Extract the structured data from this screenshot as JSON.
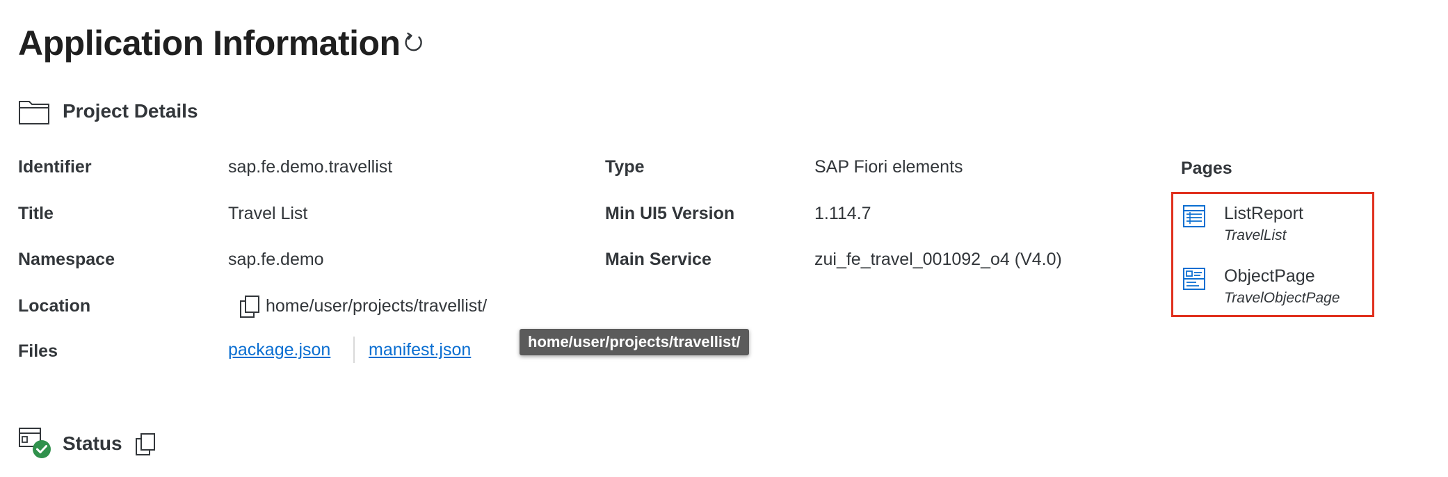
{
  "page": {
    "title": "Application Information",
    "refresh_icon": "refresh-icon"
  },
  "project_details": {
    "section_title": "Project Details",
    "icon": "folder-icon",
    "fields": {
      "identifier": {
        "label": "Identifier",
        "value": "sap.fe.demo.travellist"
      },
      "title": {
        "label": "Title",
        "value": "Travel List"
      },
      "namespace": {
        "label": "Namespace",
        "value": "sap.fe.demo"
      },
      "location": {
        "label": "Location",
        "value": "home/user/projects/travellist/"
      },
      "files": {
        "label": "Files",
        "items": [
          "package.json",
          "manifest.json"
        ]
      },
      "type": {
        "label": "Type",
        "value": "SAP Fiori elements"
      },
      "min_ui5": {
        "label": "Min UI5 Version",
        "value": "1.114.7"
      },
      "main_service": {
        "label": "Main Service",
        "value": "zui_fe_travel_001092_o4 (V4.0)"
      }
    },
    "tooltip": "home/user/projects/travellist/",
    "pages": {
      "label": "Pages",
      "items": [
        {
          "name": "ListReport",
          "entity": "TravelList",
          "icon": "list-report-icon"
        },
        {
          "name": "ObjectPage",
          "entity": "TravelObjectPage",
          "icon": "object-page-icon"
        }
      ]
    }
  },
  "status": {
    "section_title": "Status",
    "icon": "status-check-icon"
  },
  "colors": {
    "link": "#0a6ed1",
    "icon_blue": "#0a6ed1",
    "highlight_border": "#e0301e",
    "success_green": "#30914c",
    "tooltip_bg": "#5b5b5b"
  }
}
